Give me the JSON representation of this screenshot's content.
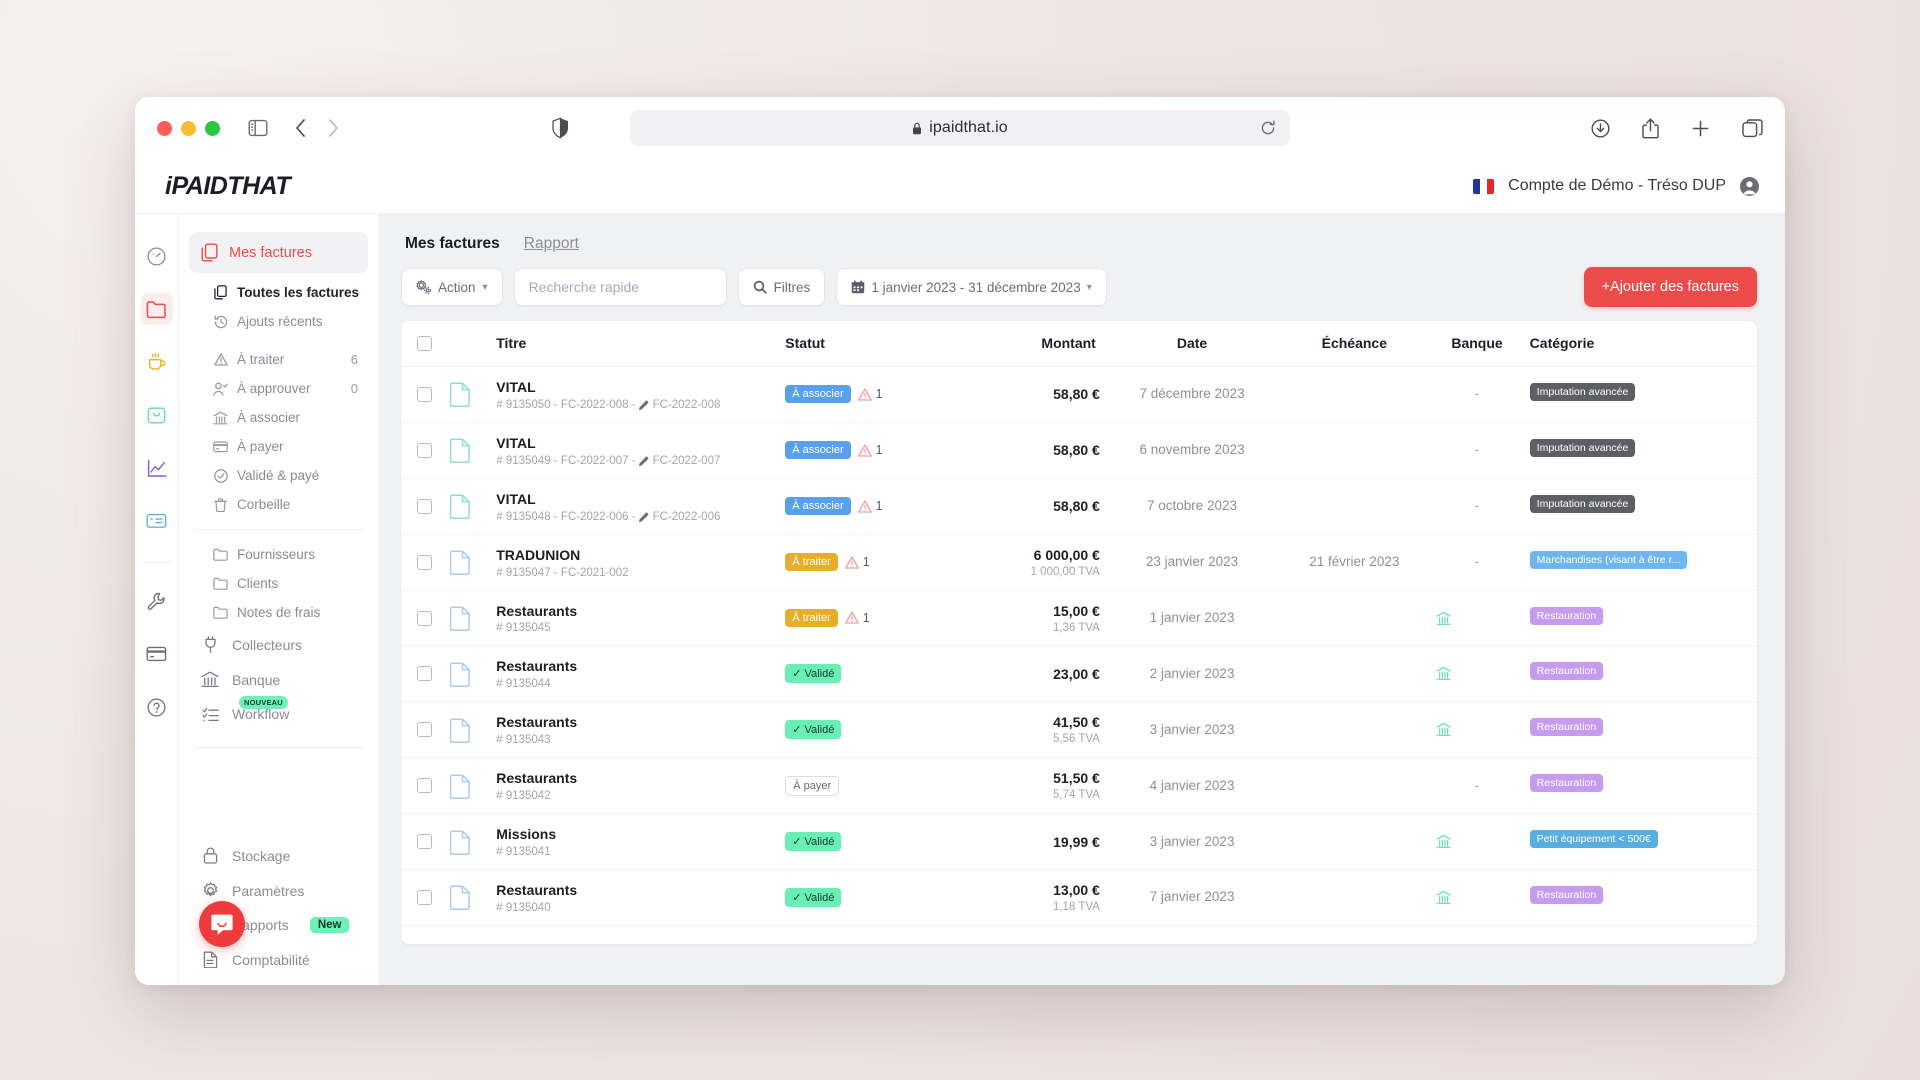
{
  "browser": {
    "url": "ipaidthat.io",
    "lock_icon": "lock-icon",
    "shield_icon": "shield-icon",
    "reload_icon": "reload-icon",
    "back_icon": "chevron-left-icon",
    "forward_icon": "chevron-right-icon",
    "sidebar_toggle_icon": "sidebar-toggle-icon",
    "download_icon": "download-icon",
    "share_icon": "share-icon",
    "newtab_icon": "plus-icon",
    "tabs_icon": "tab-overview-icon"
  },
  "header": {
    "logo_i": "i",
    "logo_paid": "PAID",
    "logo_that": "THAT",
    "account": "Compte de Démo - Tréso DUP",
    "flag": "fr-flag-icon",
    "avatar": "avatar-icon"
  },
  "rail": [
    {
      "name": "dashboard",
      "icon": "gauge-icon"
    },
    {
      "name": "invoices",
      "icon": "folder-icon",
      "active": true
    },
    {
      "name": "cafe",
      "icon": "cup-icon"
    },
    {
      "name": "inbox",
      "icon": "inbox-icon"
    },
    {
      "name": "analytics",
      "icon": "chart-line-icon"
    },
    {
      "name": "ledger",
      "icon": "receipt-icon"
    },
    {
      "name": "tools",
      "icon": "wrench-icon"
    },
    {
      "name": "card",
      "icon": "credit-card-icon"
    },
    {
      "name": "help",
      "icon": "question-icon"
    }
  ],
  "sidebar": {
    "primary": {
      "label": "Mes factures",
      "icon": "copy-documents-icon"
    },
    "sub_items": [
      {
        "label": "Toutes les factures",
        "icon": "copy-documents-icon",
        "count": "",
        "current": true
      },
      {
        "label": "Ajouts récents",
        "icon": "history-icon",
        "count": ""
      }
    ],
    "status_items": [
      {
        "label": "À traiter",
        "icon": "warning-triangle-icon",
        "count": "6"
      },
      {
        "label": "À approuver",
        "icon": "user-check-icon",
        "count": "0"
      },
      {
        "label": "À associer",
        "icon": "bank-icon",
        "count": ""
      },
      {
        "label": "À payer",
        "icon": "credit-card-icon",
        "count": ""
      },
      {
        "label": "Validé & payé",
        "icon": "check-circle-icon",
        "count": ""
      },
      {
        "label": "Corbeille",
        "icon": "trash-icon",
        "count": ""
      }
    ],
    "folder_items": [
      {
        "label": "Fournisseurs",
        "icon": "folder-outline-icon"
      },
      {
        "label": "Clients",
        "icon": "folder-outline-icon"
      },
      {
        "label": "Notes de frais",
        "icon": "folder-outline-icon"
      }
    ],
    "main_items": [
      {
        "label": "Collecteurs",
        "icon": "plug-icon",
        "badge": ""
      },
      {
        "label": "Banque",
        "icon": "bank-icon",
        "badge": ""
      },
      {
        "label": "Workflow",
        "icon": "checklist-icon",
        "badge": "NOUVEAU"
      }
    ],
    "bottom_items": [
      {
        "label": "Stockage",
        "icon": "lock-icon",
        "badge": ""
      },
      {
        "label": "Paramètres",
        "icon": "gear-icon",
        "badge": ""
      },
      {
        "label": "Rapports",
        "icon": "bar-chart-icon",
        "badge": "New"
      },
      {
        "label": "Comptabilité",
        "icon": "document-icon",
        "badge": ""
      }
    ],
    "intercom_icon": "chat-bubble-icon"
  },
  "tabs": [
    {
      "label": "Mes factures",
      "active": true
    },
    {
      "label": "Rapport",
      "active": false
    }
  ],
  "toolbar": {
    "action_label": "Action",
    "action_icon": "gears-icon",
    "action_caret": "▾",
    "search_placeholder": "Recherche rapide",
    "search_value": "",
    "filters_label": "Filtres",
    "filters_icon": "search-icon",
    "daterange_label": "1 janvier 2023 - 31 décembre 2023",
    "daterange_icon": "calendar-icon",
    "daterange_caret": "▾",
    "add_label": "+Ajouter des factures"
  },
  "table": {
    "columns": [
      "",
      "",
      "Titre",
      "Statut",
      "Montant",
      "Date",
      "Échéance",
      "Banque",
      "Catégorie"
    ],
    "rows": [
      {
        "title": "VITAL",
        "sub": "# 9135050 - FC-2022-008 -",
        "sub_edit": "FC-2022-008",
        "doc_color": "green",
        "status": "À associer",
        "status_style": "blue",
        "warn": "1",
        "amount": "58,80 €",
        "tva": "",
        "date": "7 décembre 2023",
        "echeance": "",
        "bank": "-",
        "category": "Imputation avancée",
        "cat_style": "cat-grey"
      },
      {
        "title": "VITAL",
        "sub": "# 9135049 - FC-2022-007 -",
        "sub_edit": "FC-2022-007",
        "doc_color": "green",
        "status": "À associer",
        "status_style": "blue",
        "warn": "1",
        "amount": "58,80 €",
        "tva": "",
        "date": "6 novembre 2023",
        "echeance": "",
        "bank": "-",
        "category": "Imputation avancée",
        "cat_style": "cat-grey"
      },
      {
        "title": "VITAL",
        "sub": "# 9135048 - FC-2022-006 -",
        "sub_edit": "FC-2022-006",
        "doc_color": "green",
        "status": "À associer",
        "status_style": "blue",
        "warn": "1",
        "amount": "58,80 €",
        "tva": "",
        "date": "7 octobre 2023",
        "echeance": "",
        "bank": "-",
        "category": "Imputation avancée",
        "cat_style": "cat-grey"
      },
      {
        "title": "TRADUNION",
        "sub": "# 9135047 - FC-2021-002",
        "sub_edit": "",
        "doc_color": "blue",
        "status": "À traiter",
        "status_style": "yellow",
        "warn": "1",
        "amount": "6 000,00 €",
        "tva": "1 000,00 TVA",
        "date": "23 janvier 2023",
        "echeance": "21 février 2023",
        "bank": "-",
        "category": "Marchandises (visant à être r...",
        "cat_style": "cat-blue"
      },
      {
        "title": "Restaurants",
        "sub": "# 9135045",
        "sub_edit": "",
        "doc_color": "blue",
        "status": "À traiter",
        "status_style": "yellow",
        "warn": "1",
        "amount": "15,00 €",
        "tva": "1,36 TVA",
        "date": "1 janvier 2023",
        "echeance": "",
        "bank": "bank-icon",
        "category": "Restauration",
        "cat_style": "cat-purple"
      },
      {
        "title": "Restaurants",
        "sub": "# 9135044",
        "sub_edit": "",
        "doc_color": "blue",
        "status": "✓ Validé",
        "status_style": "green",
        "warn": "",
        "amount": "23,00 €",
        "tva": "",
        "date": "2 janvier 2023",
        "echeance": "",
        "bank": "bank-icon",
        "category": "Restauration",
        "cat_style": "cat-purple"
      },
      {
        "title": "Restaurants",
        "sub": "# 9135043",
        "sub_edit": "",
        "doc_color": "blue",
        "status": "✓ Validé",
        "status_style": "green",
        "warn": "",
        "amount": "41,50 €",
        "tva": "5,56 TVA",
        "date": "3 janvier 2023",
        "echeance": "",
        "bank": "bank-icon",
        "category": "Restauration",
        "cat_style": "cat-purple"
      },
      {
        "title": "Restaurants",
        "sub": "# 9135042",
        "sub_edit": "",
        "doc_color": "blue",
        "status": "À payer",
        "status_style": "ghost",
        "warn": "",
        "amount": "51,50 €",
        "tva": "5,74 TVA",
        "date": "4 janvier 2023",
        "echeance": "",
        "bank": "-",
        "category": "Restauration",
        "cat_style": "cat-purple"
      },
      {
        "title": "Missions",
        "sub": "# 9135041",
        "sub_edit": "",
        "doc_color": "blue",
        "status": "✓ Validé",
        "status_style": "green",
        "warn": "",
        "amount": "19,99 €",
        "tva": "",
        "date": "3 janvier 2023",
        "echeance": "",
        "bank": "bank-icon",
        "category": "Petit équipement < 500€",
        "cat_style": "cat-teal"
      },
      {
        "title": "Restaurants",
        "sub": "# 9135040",
        "sub_edit": "",
        "doc_color": "blue",
        "status": "✓ Validé",
        "status_style": "green",
        "warn": "",
        "amount": "13,00 €",
        "tva": "1,18 TVA",
        "date": "7 janvier 2023",
        "echeance": "",
        "bank": "bank-icon",
        "category": "Restauration",
        "cat_style": "cat-purple"
      }
    ]
  },
  "colors": {
    "accent": "#ec4b4b",
    "blue_pill": "#58a0ec",
    "yellow_pill": "#e8ae2b",
    "green_pill": "#69efb3"
  }
}
